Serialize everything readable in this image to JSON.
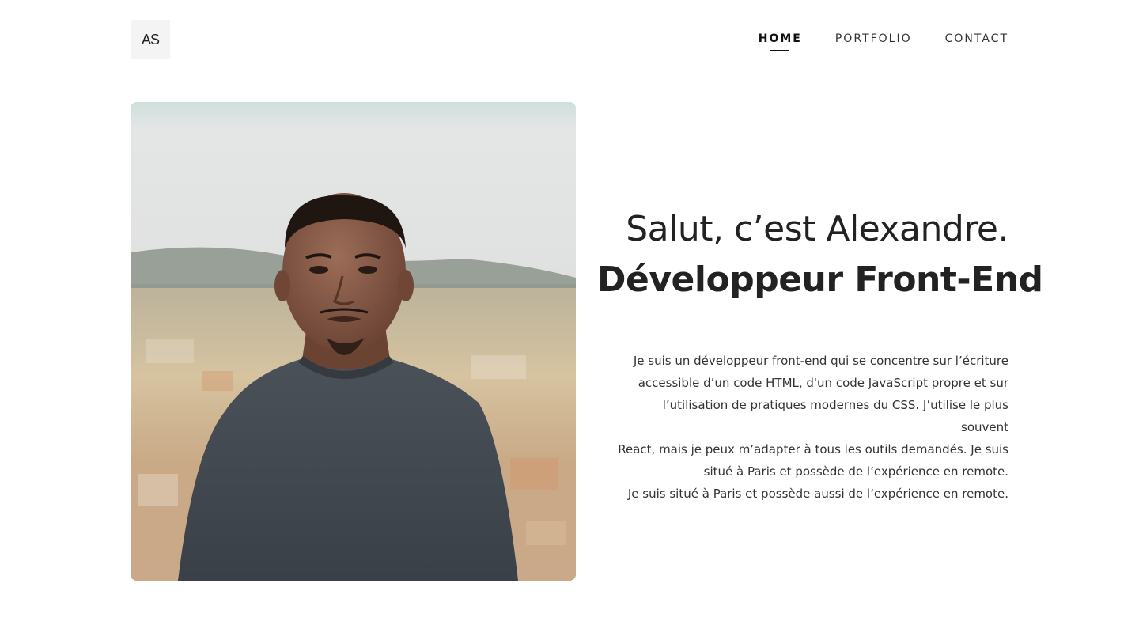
{
  "header": {
    "logo_text": "AS",
    "nav": [
      {
        "label": "HOME",
        "active": true
      },
      {
        "label": "PORTFOLIO",
        "active": false
      },
      {
        "label": "CONTACT",
        "active": false
      }
    ]
  },
  "hero": {
    "title": "Salut, c’est Alexandre.",
    "subtitle": "Développeur Front-End",
    "bio_lines": [
      "Je suis un développeur front-end qui se concentre sur l’écriture",
      "accessible d’un code HTML, d'un code JavaScript propre et sur",
      "l’utilisation de pratiques modernes du CSS. J’utilise le plus souvent",
      "React, mais je peux m’adapter à tous les outils demandés. Je suis",
      "situé à Paris et possède de l’expérience en remote.",
      "Je suis situé à Paris et possède aussi de l’expérience en remote."
    ]
  },
  "colors": {
    "text": "#222222",
    "logo_bg": "#f4f4f4",
    "background": "#ffffff"
  }
}
